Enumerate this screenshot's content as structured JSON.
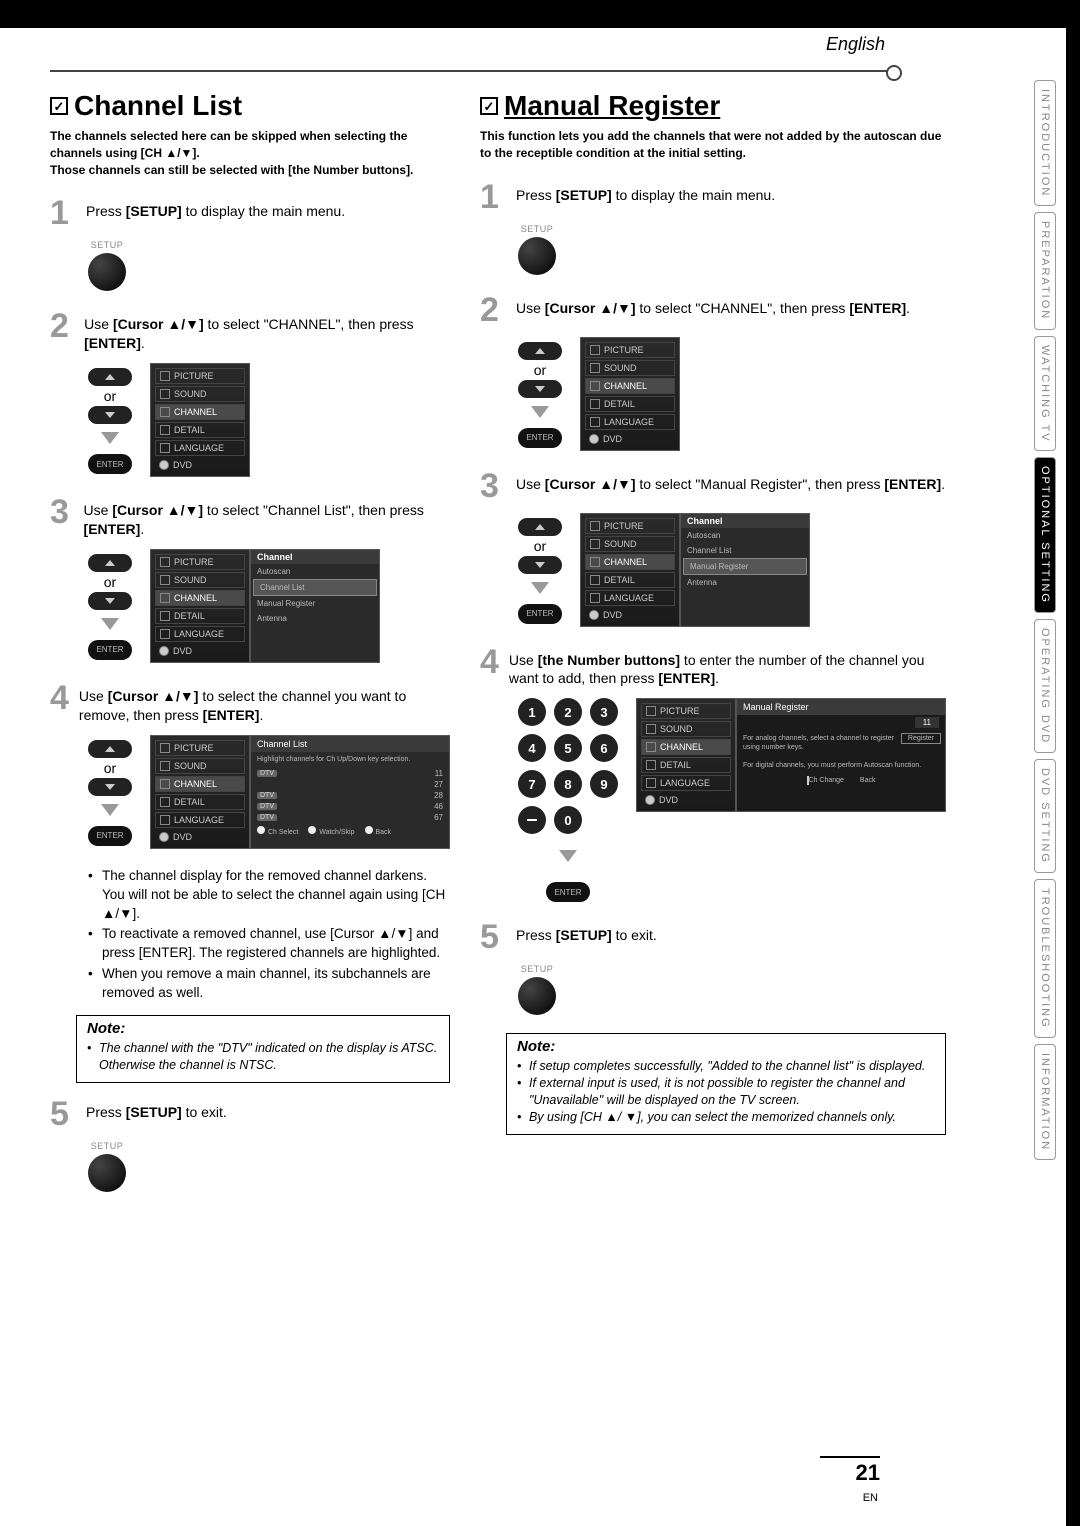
{
  "language_label": "English",
  "page_number": "21",
  "lang_code": "EN",
  "side_tabs": [
    "INTRODUCTION",
    "PREPARATION",
    "WATCHING TV",
    "OPTIONAL SETTING",
    "OPERATING DVD",
    "DVD SETTING",
    "TROUBLESHOOTING",
    "INFORMATION"
  ],
  "active_tab_index": 3,
  "left": {
    "title": "Channel List",
    "intro_line1": "The channels selected here can be skipped when selecting the channels using [CH ▲/▼].",
    "intro_line2": "Those channels can still be selected with [the Number buttons].",
    "step1": {
      "pre": "Press ",
      "b": "[SETUP]",
      "post": " to display the main menu."
    },
    "setup_label": "SETUP",
    "step2": {
      "pre": "Use ",
      "b": "[Cursor ▲/▼]",
      "mid": " to select \"CHANNEL\", then press ",
      "b2": "[ENTER]",
      "post": "."
    },
    "or": "or",
    "enter_btn": "ENTER",
    "osd_items": [
      "PICTURE",
      "SOUND",
      "CHANNEL",
      "DETAIL",
      "LANGUAGE"
    ],
    "osd_dvd": "DVD",
    "step3": {
      "pre": "Use ",
      "b": "[Cursor ▲/▼]",
      "mid": " to select \"Channel List\", then press ",
      "b2": "[ENTER]",
      "post": "."
    },
    "submenu_header": "Channel",
    "submenu_items": [
      "Autoscan",
      "Channel List",
      "Manual Register",
      "Antenna"
    ],
    "submenu_sel_index": 1,
    "step4": {
      "pre": "Use ",
      "b": "[Cursor ▲/▼]",
      "mid": " to select the channel you want to remove, then press ",
      "b2": "[ENTER]",
      "post": "."
    },
    "chlist_header": "Channel List",
    "chlist_hint": "Highlight channels for Ch Up/Down key selection.",
    "chlist_rows": [
      {
        "tag": "DTV",
        "num": "11"
      },
      {
        "tag": "",
        "num": "27"
      },
      {
        "tag": "DTV",
        "num": "28"
      },
      {
        "tag": "DTV",
        "num": "46"
      },
      {
        "tag": "DTV",
        "num": "67"
      }
    ],
    "chlist_footer": {
      "a": "Ch Select",
      "b": "Watch/Skip",
      "c": "Back"
    },
    "bullets": [
      "The channel display for the removed channel darkens. You will not be able to select the channel again using [CH ▲/▼].",
      "To reactivate a removed channel, use [Cursor ▲/▼] and press [ENTER]. The registered channels are highlighted.",
      "When you remove a main channel, its subchannels are removed as well."
    ],
    "note_title": "Note:",
    "note_items": [
      "The channel with the \"DTV\" indicated on the display is ATSC. Otherwise the channel is NTSC."
    ],
    "step5": {
      "pre": "Press ",
      "b": "[SETUP]",
      "post": " to exit."
    }
  },
  "right": {
    "title": "Manual Register",
    "intro": "This function lets you add the channels that were not added by the autoscan due to the receptible condition at the initial setting.",
    "step1": {
      "pre": "Press ",
      "b": "[SETUP]",
      "post": " to display the main menu."
    },
    "step2": {
      "pre": "Use ",
      "b": "[Cursor ▲/▼]",
      "mid": " to select \"CHANNEL\", then press ",
      "b2": "[ENTER]",
      "post": "."
    },
    "step3": {
      "pre": "Use ",
      "b": "[Cursor ▲/▼]",
      "mid": " to select \"Manual Register\", then press ",
      "b2": "[ENTER]",
      "post": "."
    },
    "submenu_sel_index": 2,
    "step4": {
      "pre": "Use ",
      "b": "[the Number buttons]",
      "mid": " to enter the number of the channel you want to add, then press ",
      "b2": "[ENTER]",
      "post": "."
    },
    "numpad": [
      "1",
      "2",
      "3",
      "4",
      "5",
      "6",
      "7",
      "8",
      "9",
      "–",
      "0",
      ""
    ],
    "reg_header": "Manual Register",
    "reg_field": "11",
    "reg_txt1": "For analog channels, select a channel to register using number keys.",
    "reg_txt2": "For digital channels, you must perform Autoscan function.",
    "reg_btn": "Register",
    "reg_footer": {
      "a": "Ch Change",
      "b": "Back"
    },
    "step5": {
      "pre": "Press ",
      "b": "[SETUP]",
      "post": " to exit."
    },
    "note_title": "Note:",
    "note_items": [
      "If setup completes successfully, \"Added to the channel list\" is displayed.",
      "If external input is used, it is not possible to register the channel and \"Unavailable\" will be displayed on the TV screen.",
      "By using [CH ▲/ ▼], you can select the memorized channels only."
    ]
  }
}
